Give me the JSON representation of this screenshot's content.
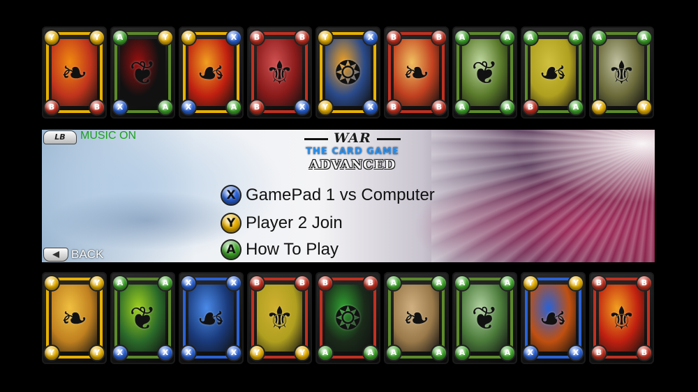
{
  "header": {
    "lb_button": "LB",
    "music_status": "MUSIC ON"
  },
  "logo": {
    "line1": "WAR",
    "line2": "THE CARD GAME",
    "line3": "ADVANCED"
  },
  "menu": {
    "items": [
      {
        "button": "X",
        "label": "GamePad 1 vs Computer",
        "color": "#2a62d6"
      },
      {
        "button": "Y",
        "label": "Player 2 Join",
        "color": "#e8b000"
      },
      {
        "button": "A",
        "label": "How To Play",
        "color": "#3fa52a"
      }
    ]
  },
  "footer": {
    "back_label": "BACK"
  },
  "cards": {
    "top": [
      {
        "frame": "#e8b000",
        "art": "#c0341c",
        "accent": "#f08a10",
        "corners": [
          "Y",
          "Y",
          "B",
          "B"
        ]
      },
      {
        "frame": "#5c8a2a",
        "art": "#111111",
        "accent": "#9a1010",
        "corners": [
          "A",
          "Y",
          "X",
          "A"
        ]
      },
      {
        "frame": "#e8b000",
        "art": "#c02010",
        "accent": "#f0a020",
        "corners": [
          "Y",
          "X",
          "X",
          "A"
        ]
      },
      {
        "frame": "#c03020",
        "art": "#8a1a1a",
        "accent": "#d05050",
        "corners": [
          "B",
          "B",
          "B",
          "X"
        ]
      },
      {
        "frame": "#e8b000",
        "art": "#2a4a8a",
        "accent": "#f0a020",
        "corners": [
          "Y",
          "X",
          "Y",
          "X"
        ]
      },
      {
        "frame": "#c03020",
        "art": "#c04020",
        "accent": "#f0c060",
        "corners": [
          "B",
          "B",
          "B",
          "B"
        ]
      },
      {
        "frame": "#5c8a2a",
        "art": "#5a7a2a",
        "accent": "#c0d8a0",
        "corners": [
          "A",
          "A",
          "A",
          "A"
        ]
      },
      {
        "frame": "#5c8a2a",
        "art": "#b0a020",
        "accent": "#d0c040",
        "corners": [
          "A",
          "A",
          "B",
          "A"
        ]
      },
      {
        "frame": "#5c8a2a",
        "art": "#6a6a3a",
        "accent": "#c0c0a0",
        "corners": [
          "A",
          "A",
          "Y",
          "Y"
        ]
      }
    ],
    "bottom": [
      {
        "frame": "#e8b000",
        "art": "#c08020",
        "accent": "#f0c040",
        "corners": [
          "Y",
          "Y",
          "Y",
          "Y"
        ]
      },
      {
        "frame": "#5c8a2a",
        "art": "#2a6a2a",
        "accent": "#a0d020",
        "corners": [
          "A",
          "A",
          "X",
          "X"
        ]
      },
      {
        "frame": "#2a62d6",
        "art": "#1a3a7a",
        "accent": "#4a8ae8",
        "corners": [
          "X",
          "X",
          "X",
          "X"
        ]
      },
      {
        "frame": "#c03020",
        "art": "#b0a020",
        "accent": "#d0b030",
        "corners": [
          "B",
          "B",
          "Y",
          "Y"
        ]
      },
      {
        "frame": "#c03020",
        "art": "#1a2a1a",
        "accent": "#30a030",
        "corners": [
          "B",
          "B",
          "A",
          "A"
        ]
      },
      {
        "frame": "#5c8a2a",
        "art": "#9a7a4a",
        "accent": "#d0b080",
        "corners": [
          "A",
          "A",
          "A",
          "A"
        ]
      },
      {
        "frame": "#5c8a2a",
        "art": "#4a7a3a",
        "accent": "#b0d0a0",
        "corners": [
          "A",
          "A",
          "A",
          "A"
        ]
      },
      {
        "frame": "#2a62d6",
        "art": "#c05010",
        "accent": "#2a62d6",
        "corners": [
          "Y",
          "Y",
          "X",
          "X"
        ]
      },
      {
        "frame": "#c03020",
        "art": "#c02010",
        "accent": "#f0a020",
        "corners": [
          "B",
          "B",
          "B",
          "B"
        ]
      }
    ]
  },
  "colors": {
    "music_on": "#1ca11c",
    "button_X": "#2a62d6",
    "button_Y": "#e8b000",
    "button_A": "#3fa52a",
    "button_B": "#c03020"
  }
}
